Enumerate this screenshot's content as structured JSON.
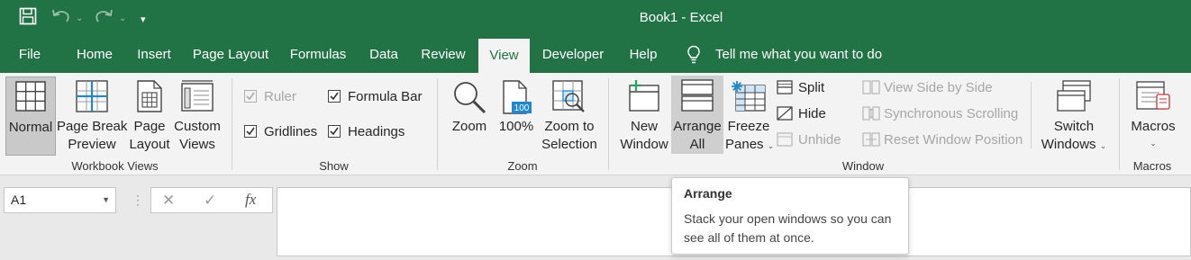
{
  "window": {
    "title": "Book1  -  Excel"
  },
  "quick_access": {
    "save_icon": "save-icon",
    "undo_icon": "undo-icon",
    "redo_icon": "redo-icon",
    "customize": "▾"
  },
  "tabs": [
    "File",
    "Home",
    "Insert",
    "Page Layout",
    "Formulas",
    "Data",
    "Review",
    "View",
    "Developer",
    "Help"
  ],
  "active_tab": "View",
  "tell_me": "Tell me what you want to do",
  "workbook_views": {
    "label": "Workbook Views",
    "normal": "Normal",
    "page_break": [
      "Page Break",
      "Preview"
    ],
    "page_layout": [
      "Page",
      "Layout"
    ],
    "custom_views": [
      "Custom",
      "Views"
    ]
  },
  "show": {
    "label": "Show",
    "ruler": "Ruler",
    "formula_bar": "Formula Bar",
    "gridlines": "Gridlines",
    "headings": "Headings",
    "ruler_checked": true,
    "ruler_disabled": true,
    "formula_bar_checked": true,
    "gridlines_checked": true,
    "headings_checked": true
  },
  "zoom": {
    "label": "Zoom",
    "zoom": "Zoom",
    "hundred": "100%",
    "hundred_icon_text": "100",
    "zoom_selection": [
      "Zoom to",
      "Selection"
    ]
  },
  "window_group": {
    "label": "Window",
    "new_window": [
      "New",
      "Window"
    ],
    "arrange_all": [
      "Arrange",
      "All"
    ],
    "freeze_panes": [
      "Freeze",
      "Panes"
    ],
    "split": "Split",
    "hide": "Hide",
    "unhide": "Unhide",
    "view_side_by_side": "View Side by Side",
    "sync_scrolling": "Synchronous Scrolling",
    "reset_position": "Reset Window Position",
    "switch_windows": [
      "Switch",
      "Windows"
    ]
  },
  "macros": {
    "label": "Macros",
    "macros": "Macros"
  },
  "formula_bar": {
    "name_box": "A1",
    "cancel_symbol": "✕",
    "enter_symbol": "✓",
    "fx_symbol": "fx",
    "value": ""
  },
  "tooltip": {
    "title": "Arrange",
    "body": "Stack your open windows so you can see all of them at once."
  },
  "colors": {
    "excel_green": "#217346",
    "ribbon_bg": "#f3f3f3",
    "freeze_blue": "#1e88d2"
  }
}
